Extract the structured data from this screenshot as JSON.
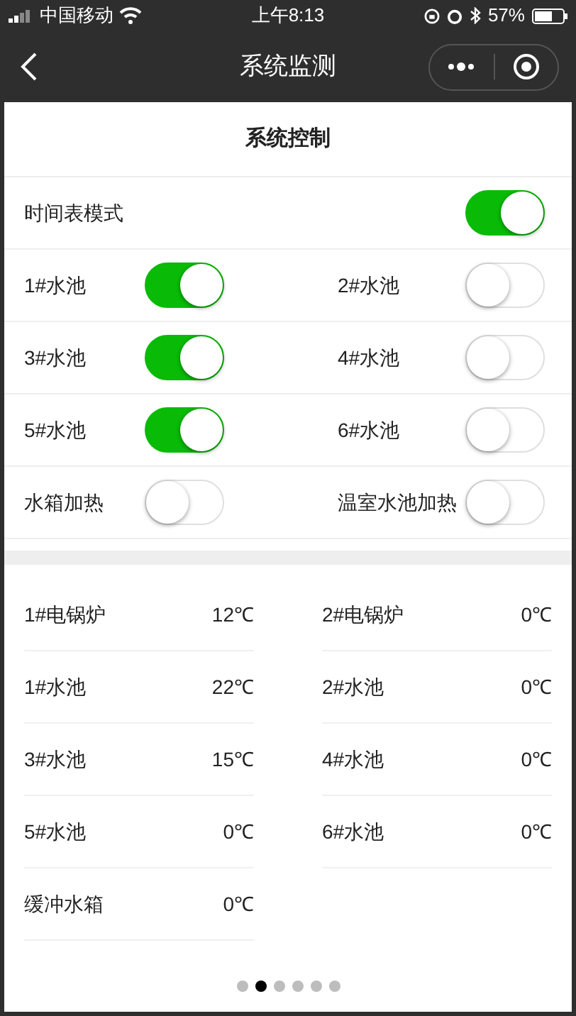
{
  "status_bar": {
    "carrier": "中国移动",
    "time": "上午8:13",
    "battery": "57%"
  },
  "nav": {
    "title": "系统监测"
  },
  "control": {
    "title": "系统控制",
    "schedule": {
      "label": "时间表模式",
      "on": true
    },
    "switches": [
      {
        "label": "1#水池",
        "on": true
      },
      {
        "label": "2#水池",
        "on": false
      },
      {
        "label": "3#水池",
        "on": true
      },
      {
        "label": "4#水池",
        "on": false
      },
      {
        "label": "5#水池",
        "on": true
      },
      {
        "label": "6#水池",
        "on": false
      },
      {
        "label": "水箱加热",
        "on": false
      },
      {
        "label": "温室水池加热",
        "on": false
      }
    ]
  },
  "temperatures": [
    {
      "name": "1#电锅炉",
      "value": "12℃"
    },
    {
      "name": "2#电锅炉",
      "value": "0℃"
    },
    {
      "name": "1#水池",
      "value": "22℃"
    },
    {
      "name": "2#水池",
      "value": "0℃"
    },
    {
      "name": "3#水池",
      "value": "15℃"
    },
    {
      "name": "4#水池",
      "value": "0℃"
    },
    {
      "name": "5#水池",
      "value": "0℃"
    },
    {
      "name": "6#水池",
      "value": "0℃"
    },
    {
      "name": "缓冲水箱",
      "value": "0℃"
    }
  ],
  "pager": [
    {
      "selected": false
    },
    {
      "selected": true
    },
    {
      "selected": false
    },
    {
      "selected": false
    },
    {
      "selected": false
    },
    {
      "selected": false
    }
  ]
}
